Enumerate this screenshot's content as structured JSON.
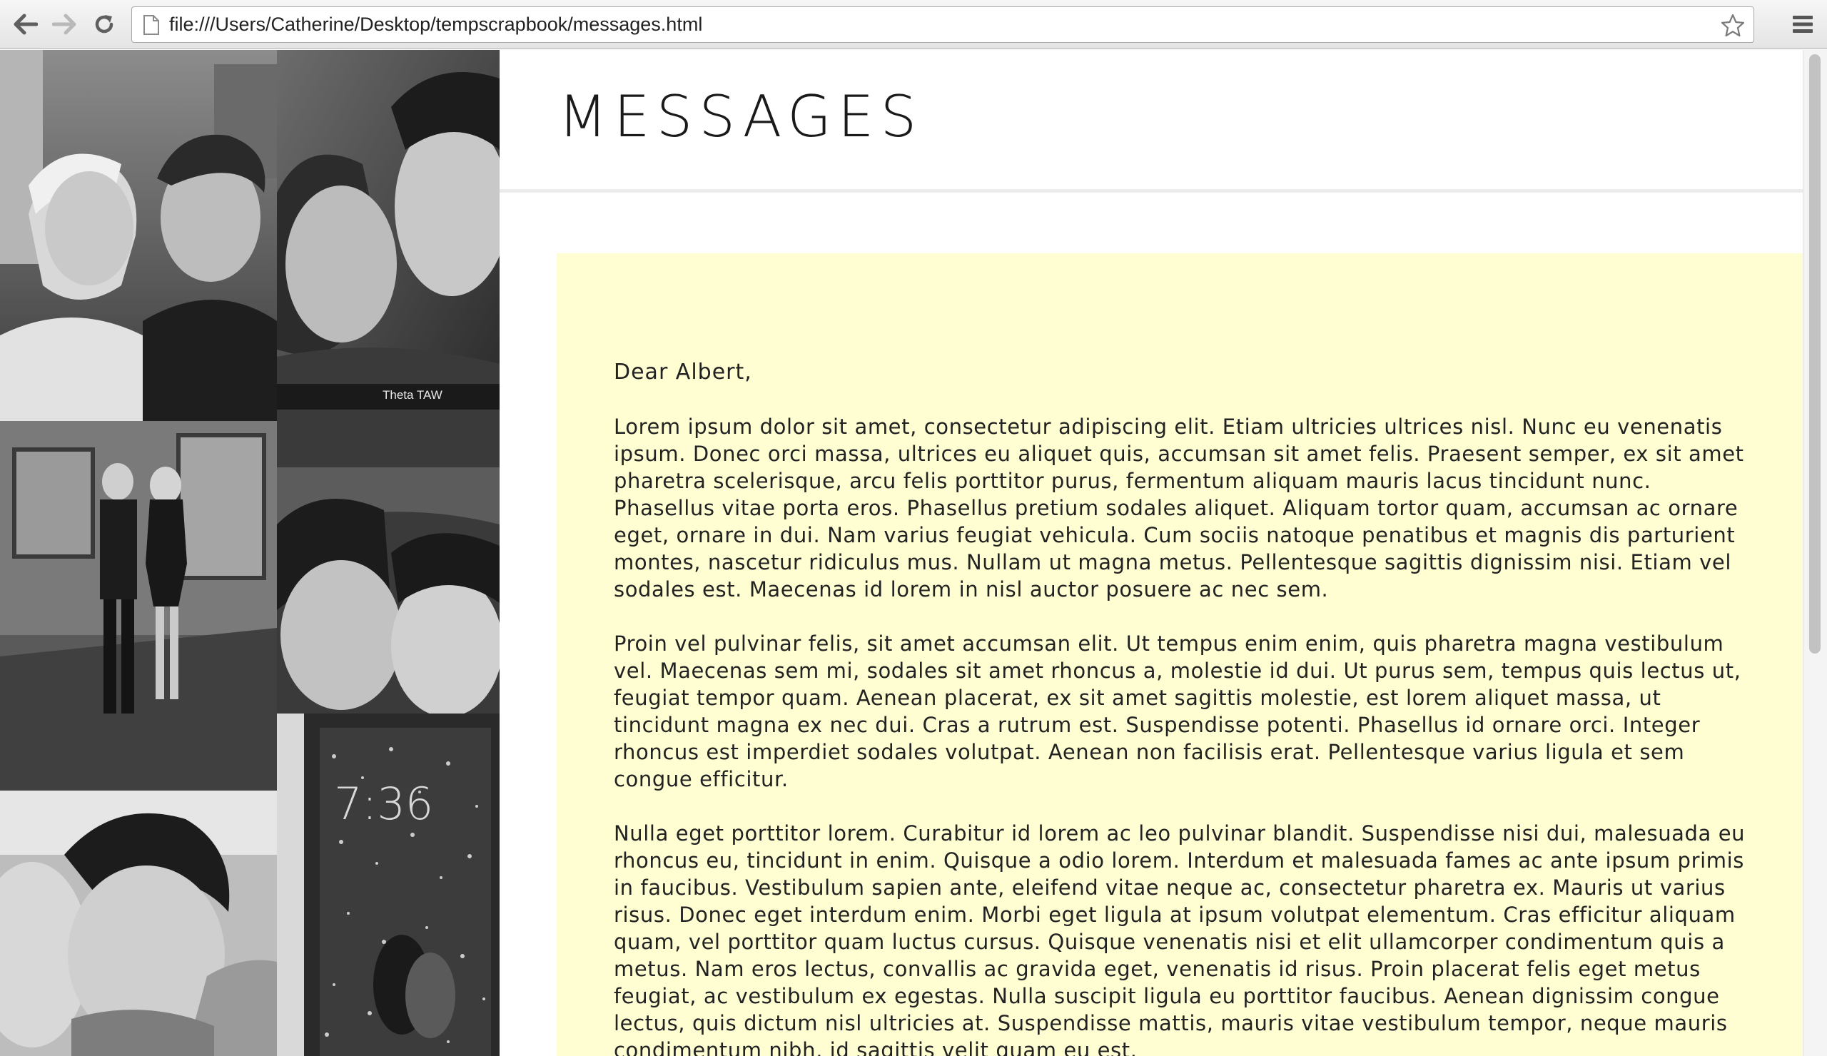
{
  "browser": {
    "url": "file:///Users/Catherine/Desktop/tempscrapbook/messages.html",
    "icons": {
      "back": "arrow-left-icon",
      "forward": "arrow-right-icon",
      "reload": "reload-icon",
      "page": "document-icon",
      "bookmark": "star-icon",
      "menu": "hamburger-menu-icon"
    }
  },
  "page": {
    "title": "MESSAGES",
    "card_color": "#fefed2",
    "photos": [
      {
        "id": "photo-couple-christmas-hats"
      },
      {
        "id": "photo-couple-selfie-theta-taw",
        "caption": "Theta TAW"
      },
      {
        "id": "photo-couple-formal-standing"
      },
      {
        "id": "photo-couple-selfie-night"
      },
      {
        "id": "photo-couple-kiss"
      },
      {
        "id": "photo-phone-lockscreen-christmas-tree",
        "clock": "7:36"
      }
    ],
    "message": {
      "greeting": "Dear Albert,",
      "paragraphs": [
        "Lorem ipsum dolor sit amet, consectetur adipiscing elit. Etiam ultricies ultrices nisl. Nunc eu venenatis ipsum. Donec orci massa, ultrices eu aliquet quis, accumsan sit amet felis. Praesent semper, ex sit amet pharetra scelerisque, arcu felis porttitor purus, fermentum aliquam mauris lacus tincidunt nunc. Phasellus vitae porta eros. Phasellus pretium sodales aliquet. Aliquam tortor quam, accumsan ac ornare eget, ornare in dui. Nam varius feugiat vehicula. Cum sociis natoque penatibus et magnis dis parturient montes, nascetur ridiculus mus. Nullam ut magna metus. Pellentesque sagittis dignissim nisi. Etiam vel sodales est. Maecenas id lorem in nisl auctor posuere ac nec sem.",
        "Proin vel pulvinar felis, sit amet accumsan elit. Ut tempus enim enim, quis pharetra magna vestibulum vel. Maecenas sem mi, sodales sit amet rhoncus a, molestie id dui. Ut purus sem, tempus quis lectus ut, feugiat tempor quam. Aenean placerat, ex sit amet sagittis molestie, est lorem aliquet massa, ut tincidunt magna ex nec dui. Cras a rutrum est. Suspendisse potenti. Phasellus id ornare orci. Integer rhoncus est imperdiet sodales volutpat. Aenean non facilisis erat. Pellentesque varius ligula et sem congue efficitur.",
        "Nulla eget porttitor lorem. Curabitur id lorem ac leo pulvinar blandit. Suspendisse nisi dui, malesuada eu rhoncus eu, tincidunt in enim. Quisque a odio lorem. Interdum et malesuada fames ac ante ipsum primis in faucibus. Vestibulum sapien ante, eleifend vitae neque ac, consectetur pharetra ex. Mauris ut varius risus. Donec eget interdum enim. Morbi eget ligula at ipsum volutpat elementum. Cras efficitur aliquam quam, vel porttitor quam luctus cursus. Quisque venenatis nisi et elit ullamcorper condimentum quis a metus. Nam eros lectus, convallis ac gravida eget, venenatis id risus. Proin placerat felis eget metus feugiat, ac vestibulum ex egestas. Nulla suscipit ligula eu porttitor faucibus. Aenean dignissim congue lectus, quis dictum nisl ultricies at. Suspendisse mattis, mauris vitae vestibulum tempor, neque mauris condimentum nibh, id sagittis velit quam eu est."
      ]
    }
  }
}
